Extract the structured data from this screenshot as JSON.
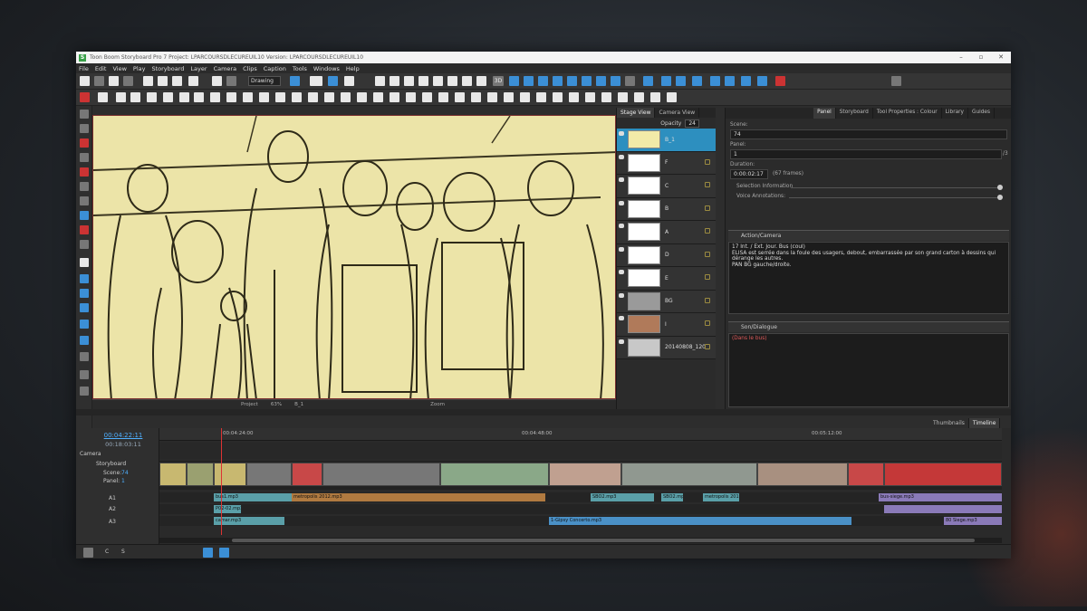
{
  "app": {
    "title": "Toon Boom Storyboard Pro 7 Project: LPARCOURSDLECUREUIL10 Version: LPARCOURSDLECUREUIL10",
    "menu": [
      "File",
      "Edit",
      "View",
      "Play",
      "Storyboard",
      "Layer",
      "Camera",
      "Clips",
      "Caption",
      "Tools",
      "Windows",
      "Help"
    ]
  },
  "toolbar": {
    "tool_dropdown": "Drawing",
    "zoom_label": "3D"
  },
  "stage": {
    "tabs": [
      "Stage View",
      "Camera View"
    ],
    "bottom_project": "Project",
    "bottom_zoom": "63%",
    "bottom_layer": "B_1",
    "bottom_zoom_label": "Zoom"
  },
  "layers": {
    "opacity_label": "Opacity",
    "opacity_value": "24",
    "items": [
      {
        "name": "B_1"
      },
      {
        "name": "F"
      },
      {
        "name": "C"
      },
      {
        "name": "B"
      },
      {
        "name": "A"
      },
      {
        "name": "D"
      },
      {
        "name": "E"
      },
      {
        "name": "BG"
      },
      {
        "name": "I"
      },
      {
        "name": "20140808_12042"
      }
    ]
  },
  "panel": {
    "tabs": [
      "Panel",
      "Storyboard",
      "Tool Properties : Colour",
      "Library",
      "Guides"
    ],
    "scene_label": "Scene:",
    "scene_value": "74",
    "panel_label": "Panel:",
    "panel_value": "1",
    "panel_total": "/3",
    "duration_label": "Duration:",
    "duration_value": "0:00:02:17",
    "duration_frames": "(67 frames)",
    "selection_info": "Selection Information",
    "voice_annotations": "Voice Annotations:",
    "action_header": "Action/Camera",
    "action_text_line1": "17                        Int. / Ext. Jour. Bus (coul)",
    "action_text_line2": "ELISA est serrée dans la foule des usagers, debout, embarrassée par son grand carton à dessins qui dérange les autres.",
    "action_text_line3": "PAN BG gauche/droite.",
    "dialogue_header": "Son/Dialogue",
    "dialogue_text": "(Dans le bus)"
  },
  "timeline": {
    "tabs": [
      "Thumbnails",
      "Timeline"
    ],
    "timecode": "00:04:22:11",
    "sub_timecode": "00:18:03:11",
    "ruler": [
      "00:04:24:00",
      "00:04:48:00",
      "00:05:12:00"
    ],
    "camera_label": "Camera",
    "storyboard_label": "Storyboard",
    "scene_label": "Scene:",
    "scene_value": "74",
    "panel_label": "Panel:",
    "panel_value": "1",
    "tracks": [
      "A1",
      "A2",
      "A3"
    ],
    "clips_a1": [
      "bus1.mp3",
      "bus1.mp3",
      "metropolis 2012.mp3",
      "metropolis 2012.mp3",
      "SBO2.mp3",
      "SBO2.mp3",
      "bus-siege.mp3",
      "bus-siege.mp3"
    ],
    "clips_a2": [
      "P02-02.mp3"
    ],
    "clips_a3": [
      "camar.mp3",
      "1-Gipsy Concerto.mp3",
      "80 Siege.mp3"
    ],
    "bottom_c": "C",
    "bottom_s": "S"
  }
}
